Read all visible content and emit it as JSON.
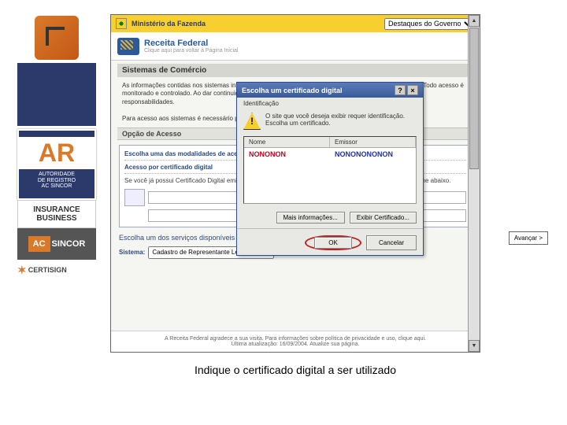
{
  "left_sidebar": {
    "ar_text_big": "AR",
    "ar_sub1": "AUTORIDADE",
    "ar_sub2": "DE REGISTRO",
    "ar_sub3": "AC SINCOR",
    "insurance_line1": "INSURANCE",
    "insurance_line2": "BUSINESS",
    "ac_text": "AC",
    "sincor_text": "SINCOR",
    "certisign_text": "CERTISIGN"
  },
  "gov_bar": {
    "title": "Ministério da Fazenda",
    "dropdown": "Destaques do Governo"
  },
  "rf_header": {
    "title": "Receita Federal",
    "subtitle": "Clique aqui para voltar à Página Inicial"
  },
  "page": {
    "section_title": "Sistemas de Comércio",
    "body_text": "As informações contidas nos sistemas informatizados da Administração Pública estão protegidas por sigilo. Todo acesso é monitorado e controlado. Ao dar continuidade à navegação neste serviço o usuário declara-se ciente das responsabilidades.",
    "body_text2": "Para acesso aos sistemas é necessário possuir certificado digital de Pessoa Física.",
    "subbar1": "Opção de Acesso",
    "panel_head1": "Escolha uma das modalidades de acesso",
    "panel_head2": "Acesso por certificado digital",
    "panel_text": "Se você já possui Certificado Digital emitido por Autoridade Certificadora para Pessoa Física, clique no ícone abaixo.",
    "subbar2": "Escolha um dos serviços disponíveis",
    "sys_label": "Sistema:",
    "sys_value": "Cadastro de Representante Lega",
    "footer_line1": "A Receita Federal agradece a sua visita. Para informações sobre política de privacidade e uso, clique aqui.",
    "footer_line2": "Última atualização: 16/09/2004. Atualize sua página."
  },
  "dialog": {
    "title": "Escolha um certificado digital",
    "subheader": "Identificação",
    "msg_line1": "O site que você deseja exibir requer identificação.",
    "msg_line2": "Escolha um certificado.",
    "col1": "Nome",
    "col2": "Emissor",
    "cert_name": "NONONON",
    "cert_issuer": "NONONONONON",
    "btn_more": "Mais informações...",
    "btn_view": "Exibir Certificado...",
    "btn_ok": "OK",
    "btn_cancel": "Cancelar",
    "help_label": "?",
    "close_label": "×"
  },
  "side_button": "Avançar >",
  "caption": "Indique o certificado digital a ser utilizado"
}
